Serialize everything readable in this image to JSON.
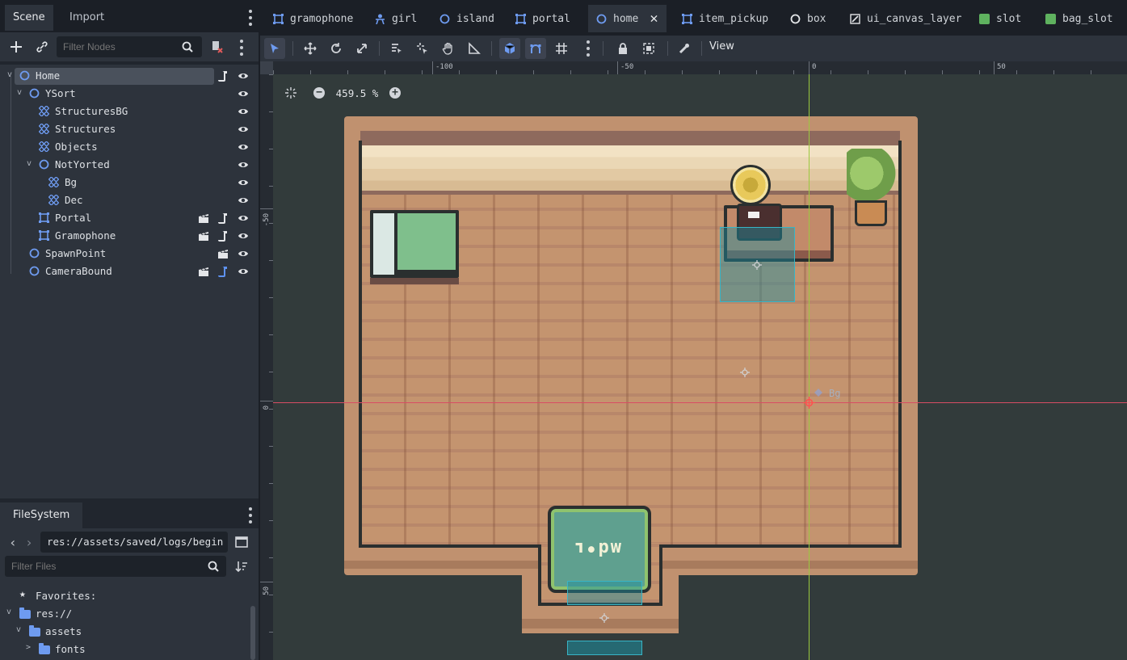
{
  "left_dock": {
    "tabs": [
      "Scene",
      "Import"
    ],
    "filter_placeholder": "Filter Nodes",
    "tree": [
      {
        "label": "Home",
        "indent": 0,
        "icon": "node2d-icon",
        "expanded": true,
        "selected": true
      },
      {
        "label": "YSort",
        "indent": 1,
        "icon": "node2d-icon",
        "expanded": true
      },
      {
        "label": "StructuresBG",
        "indent": 2,
        "icon": "tilemap-icon"
      },
      {
        "label": "Structures",
        "indent": 2,
        "icon": "tilemap-icon"
      },
      {
        "label": "Objects",
        "indent": 2,
        "icon": "tilemap-icon"
      },
      {
        "label": "NotYorted",
        "indent": 2,
        "icon": "node2d-icon",
        "expanded": true
      },
      {
        "label": "Bg",
        "indent": 3,
        "icon": "tilemap-icon"
      },
      {
        "label": "Dec",
        "indent": 3,
        "icon": "tilemap-icon"
      },
      {
        "label": "Portal",
        "indent": 2,
        "icon": "area2d-icon"
      },
      {
        "label": "Gramophone",
        "indent": 2,
        "icon": "area2d-icon"
      },
      {
        "label": "SpawnPoint",
        "indent": 1,
        "icon": "node2d-icon"
      },
      {
        "label": "CameraBound",
        "indent": 1,
        "icon": "node2d-icon"
      }
    ]
  },
  "filesystem": {
    "tab": "FileSystem",
    "path": "res://assets/saved/logs/begin",
    "filter_placeholder": "Filter Files",
    "items": [
      "Favorites:",
      "res://",
      "assets",
      "fonts"
    ]
  },
  "scene_tabs": [
    {
      "label": "gramophone",
      "icon": "area2d-icon"
    },
    {
      "label": "girl",
      "icon": "character-icon"
    },
    {
      "label": "island",
      "icon": "node2d-icon"
    },
    {
      "label": "portal",
      "icon": "area2d-icon"
    },
    {
      "label": "home",
      "icon": "node2d-icon",
      "active": true
    },
    {
      "label": "item_pickup",
      "icon": "area2d-icon"
    },
    {
      "label": "box",
      "icon": "node-icon"
    },
    {
      "label": "ui_canvas_layer",
      "icon": "canvaslayer-icon"
    },
    {
      "label": "slot",
      "icon": "control-icon"
    },
    {
      "label": "bag_slot",
      "icon": "control-icon"
    }
  ],
  "toolbar": {
    "view_label": "View"
  },
  "viewport": {
    "zoom_label": "459.5 %",
    "ruler_top": [
      "-100",
      "-50",
      "0",
      "50"
    ],
    "ruler_left": [
      "-50",
      "0",
      "50"
    ],
    "origin_node_label": "Bg",
    "rug_text": "ʍd•ʟ",
    "colors": {
      "accent": "#6e9bf0",
      "viewport_bg": "#323b3b",
      "wall": "#c0916f",
      "floor": "#c4946f",
      "collision": "#1d8fa0"
    }
  }
}
